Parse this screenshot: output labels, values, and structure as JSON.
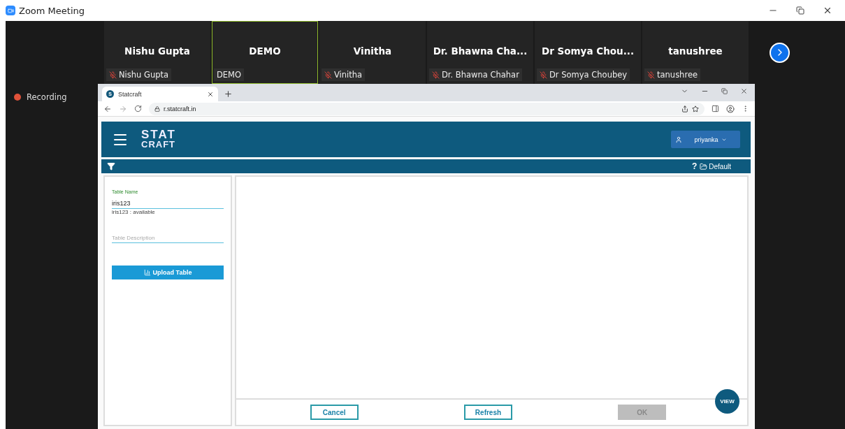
{
  "window": {
    "title": "Zoom Meeting"
  },
  "participants": [
    {
      "display_name": "Nishu Gupta",
      "label": "Nishu Gupta",
      "muted": true,
      "highlighted": false
    },
    {
      "display_name": "DEMO",
      "label": "DEMO",
      "muted": false,
      "highlighted": true
    },
    {
      "display_name": "Vinitha",
      "label": "Vinitha",
      "muted": true,
      "highlighted": false
    },
    {
      "display_name": "Dr. Bhawna Cha...",
      "label": "Dr. Bhawna Chahar",
      "muted": true,
      "highlighted": false
    },
    {
      "display_name": "Dr Somya Chou...",
      "label": "Dr Somya Choubey",
      "muted": true,
      "highlighted": false
    },
    {
      "display_name": "tanushree",
      "label": "tanushree",
      "muted": true,
      "highlighted": false
    }
  ],
  "recording": {
    "label": "Recording"
  },
  "browser": {
    "tab": {
      "title": "Statcraft",
      "favicon": "S"
    },
    "url": "r.statcraft.in"
  },
  "app": {
    "logo": {
      "line_1": "STAT",
      "line_2": "CRAFT"
    },
    "user": "priyanka",
    "help": "?",
    "workspace": "Default",
    "form": {
      "name_label": "Table Name",
      "name_value": "iris123",
      "name_status": "iris123 : available",
      "description_placeholder": "Table Description",
      "upload_button": "Upload Table"
    },
    "footer": [
      {
        "label": "Cancel",
        "disabled": false
      },
      {
        "label": "Refresh",
        "disabled": false
      },
      {
        "label": "OK",
        "disabled": true
      }
    ],
    "view_button": "VIEW"
  }
}
